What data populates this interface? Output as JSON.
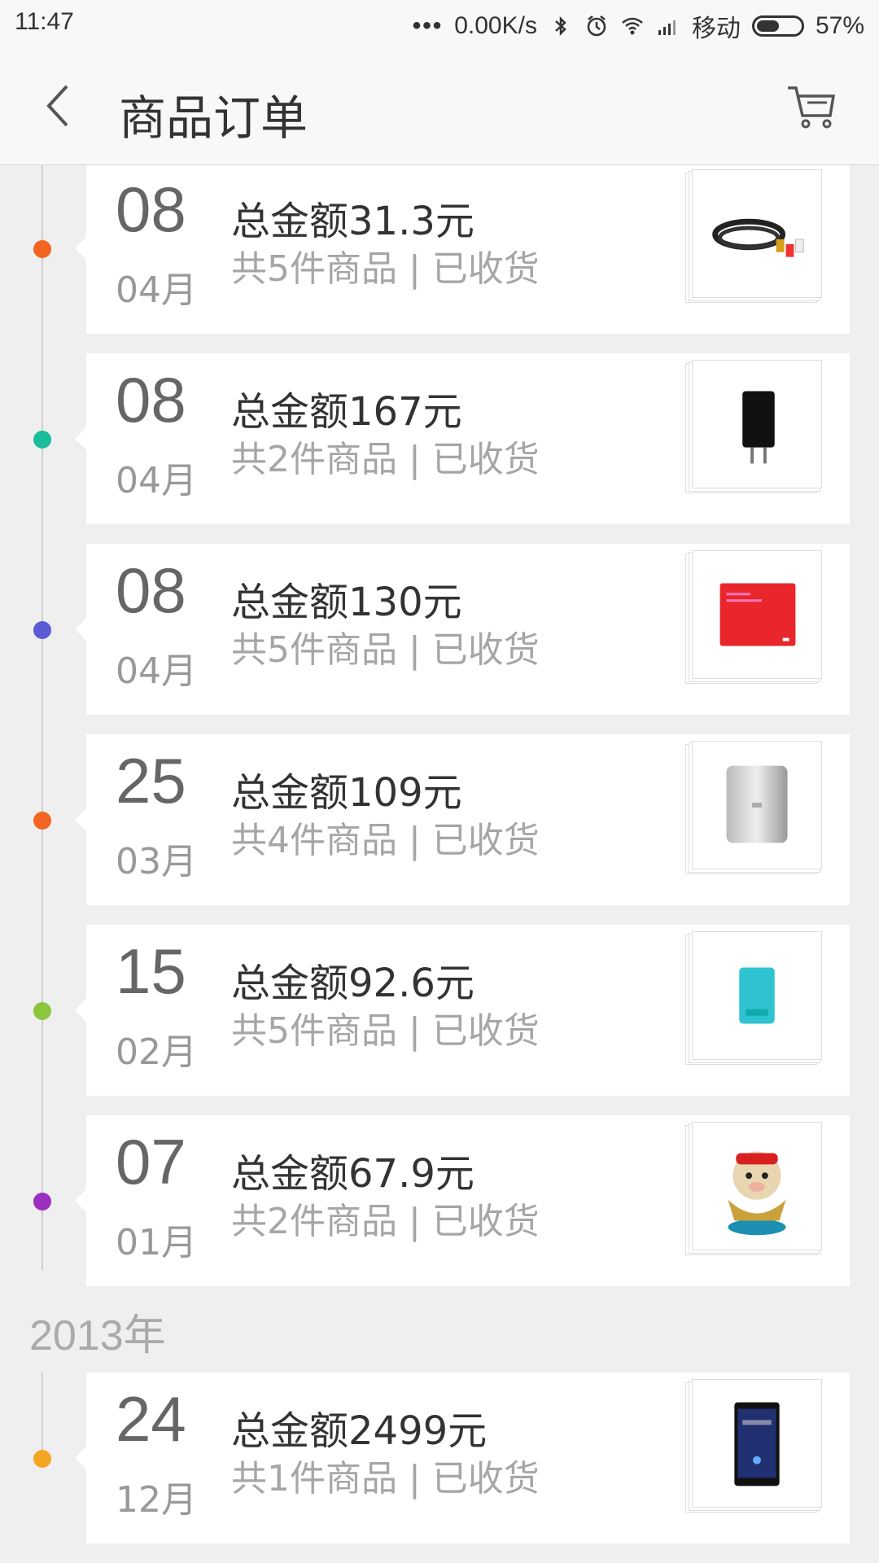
{
  "status_bar": {
    "time": "11:47",
    "network_speed": "0.00K/s",
    "carrier": "移动",
    "battery_percent": "57%",
    "battery_level": 0.57,
    "icons": [
      "more-dots-icon",
      "bluetooth-icon",
      "alarm-icon",
      "wifi-icon",
      "signal-icon",
      "battery-icon"
    ]
  },
  "header": {
    "title": "商品订单",
    "back_icon": "back-arrow-icon",
    "cart_icon": "shopping-cart-icon"
  },
  "orders": [
    {
      "day": "08",
      "month": "04月",
      "total": "总金额31.3元",
      "meta": "共5件商品 | 已收货",
      "dot_color": "#f26522",
      "thumb": "av-cable"
    },
    {
      "day": "08",
      "month": "04月",
      "total": "总金额167元",
      "meta": "共2件商品 | 已收货",
      "dot_color": "#1bbc9b",
      "thumb": "charger"
    },
    {
      "day": "08",
      "month": "04月",
      "total": "总金额130元",
      "meta": "共5件商品 | 已收货",
      "dot_color": "#5b5bd6",
      "thumb": "red-mousepad"
    },
    {
      "day": "25",
      "month": "03月",
      "total": "总金额109元",
      "meta": "共4件商品 | 已收货",
      "dot_color": "#f26522",
      "thumb": "power-bank"
    },
    {
      "day": "15",
      "month": "02月",
      "total": "总金额92.6元",
      "meta": "共5件商品 | 已收货",
      "dot_color": "#8cc63f",
      "thumb": "usb-wifi"
    },
    {
      "day": "07",
      "month": "01月",
      "total": "总金额67.9元",
      "meta": "共2件商品 | 已收货",
      "dot_color": "#9b30c0",
      "thumb": "mascot-figure"
    }
  ],
  "year_label": "2013年",
  "orders_2013": [
    {
      "day": "24",
      "month": "12月",
      "total": "总金额2499元",
      "meta": "共1件商品 | 已收货",
      "dot_color": "#f5a623",
      "thumb": "phone"
    }
  ]
}
